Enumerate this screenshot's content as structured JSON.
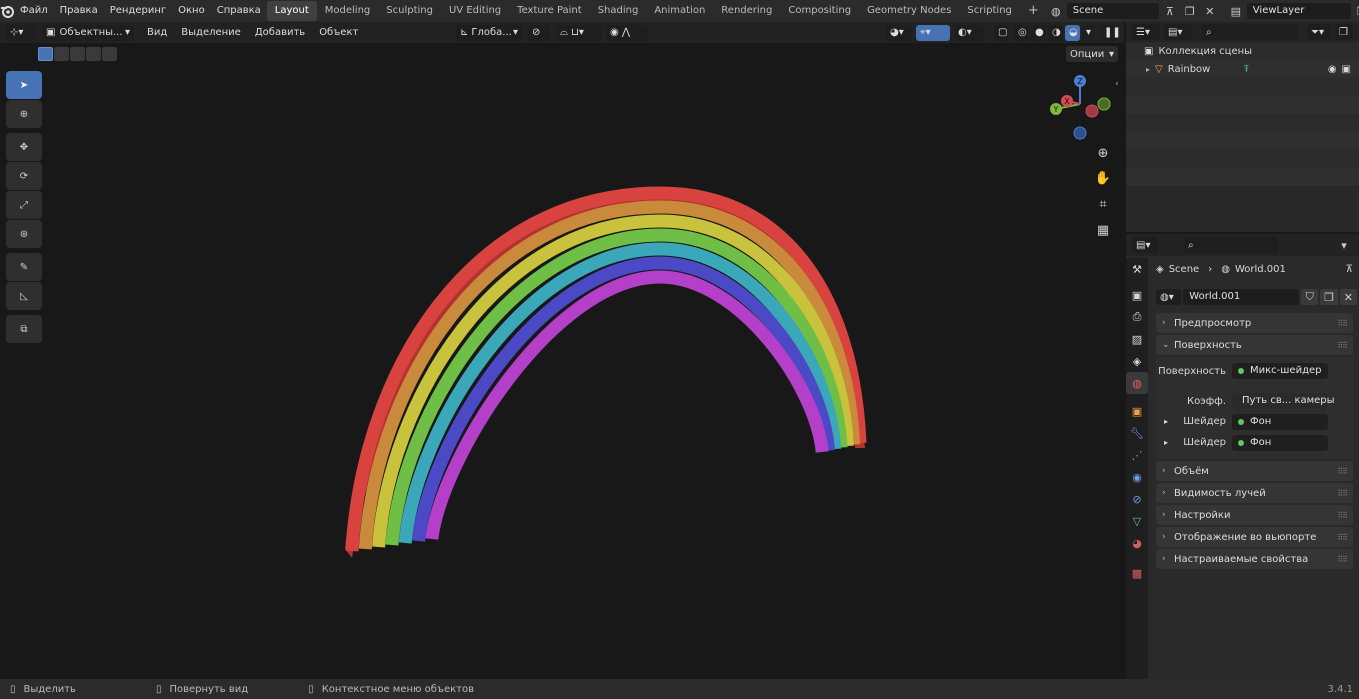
{
  "topbar": {
    "menus": [
      "Файл",
      "Правка",
      "Рендеринг",
      "Окно",
      "Справка"
    ],
    "workspaces": [
      "Layout",
      "Modeling",
      "Sculpting",
      "UV Editing",
      "Texture Paint",
      "Shading",
      "Animation",
      "Rendering",
      "Compositing",
      "Geometry Nodes",
      "Scripting"
    ],
    "active_workspace": "Layout",
    "add_workspace": "+",
    "scene": "Scene",
    "view_layer": "ViewLayer"
  },
  "viewport_header": {
    "mode": "Объектны...",
    "menus": [
      "Вид",
      "Выделение",
      "Добавить",
      "Объект"
    ],
    "orientation": "Глоба...",
    "options": "Опции"
  },
  "gizmo": {
    "x": "X",
    "y": "Y",
    "z": "Z"
  },
  "outliner": {
    "collection": "Коллекция сцены",
    "object": "Rainbow"
  },
  "properties": {
    "breadcrumb_scene": "Scene",
    "breadcrumb_world": "World.001",
    "world_name": "World.001",
    "panels": {
      "preview": "Предпросмотр",
      "surface": "Поверхность",
      "volume": "Объём",
      "ray_visibility": "Видимость лучей",
      "settings": "Настройки",
      "viewport_display": "Отображение во вьюпорте",
      "custom_props": "Настраиваемые свойства"
    },
    "surface": {
      "surface_label": "Поверхность",
      "surface_value": "Микс-шейдер",
      "factor_label": "Коэфф.",
      "factor_value": "Путь св... камеры",
      "shader1_label": "Шейдер",
      "shader1_value": "Фон",
      "shader2_label": "Шейдер",
      "shader2_value": "Фон"
    }
  },
  "status": {
    "select": "Выделить",
    "rotate": "Повернуть вид",
    "context": "Контекстное меню объектов",
    "version": "3.4.1"
  },
  "colors": {
    "accent": "#4772b3",
    "rainbow": [
      "#d8433f",
      "#c98a3b",
      "#c9c23d",
      "#6fbe45",
      "#3aa8b8",
      "#4b49c6",
      "#b43fc8"
    ]
  }
}
